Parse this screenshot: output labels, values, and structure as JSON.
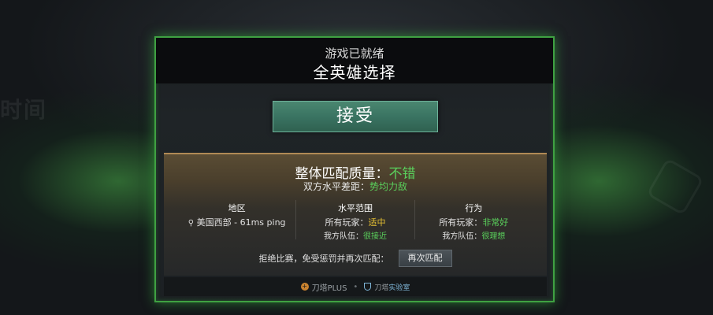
{
  "background": {
    "ghost_text": "时间"
  },
  "dialog": {
    "subtitle": "游戏已就绪",
    "title": "全英雄选择",
    "accept_label": "接受"
  },
  "match_info": {
    "quality_label": "整体匹配质量：",
    "quality_value": "不错",
    "skill_label": "双方水平差距：",
    "skill_value": "势均力敌",
    "columns": [
      {
        "header": "地区",
        "line1": "美国西部 - 61ms ping"
      },
      {
        "header": "水平范围",
        "line1_label": "所有玩家：",
        "line1_value": "适中",
        "line2_label": "我方队伍：",
        "line2_value": "很接近"
      },
      {
        "header": "行为",
        "line1_label": "所有玩家：",
        "line1_value": "非常好",
        "line2_label": "我方队伍：",
        "line2_value": "很理想"
      }
    ],
    "penalty_text": "拒绝比赛，免受惩罚并再次匹配：",
    "rematch_label": "再次匹配"
  },
  "footer": {
    "plus_label": "刀塔PLUS",
    "separator": "•",
    "lab_prefix": "刀塔",
    "lab_suffix": "实验室"
  },
  "colors": {
    "border_green": "#3fa142",
    "value_green": "#5ad05c",
    "value_yellow": "#e8c233",
    "accept_button": "#3a7462"
  },
  "icons": {
    "location": "location-pin-icon",
    "plus": "dota-plus-icon",
    "lab": "arcade-lab-icon"
  }
}
